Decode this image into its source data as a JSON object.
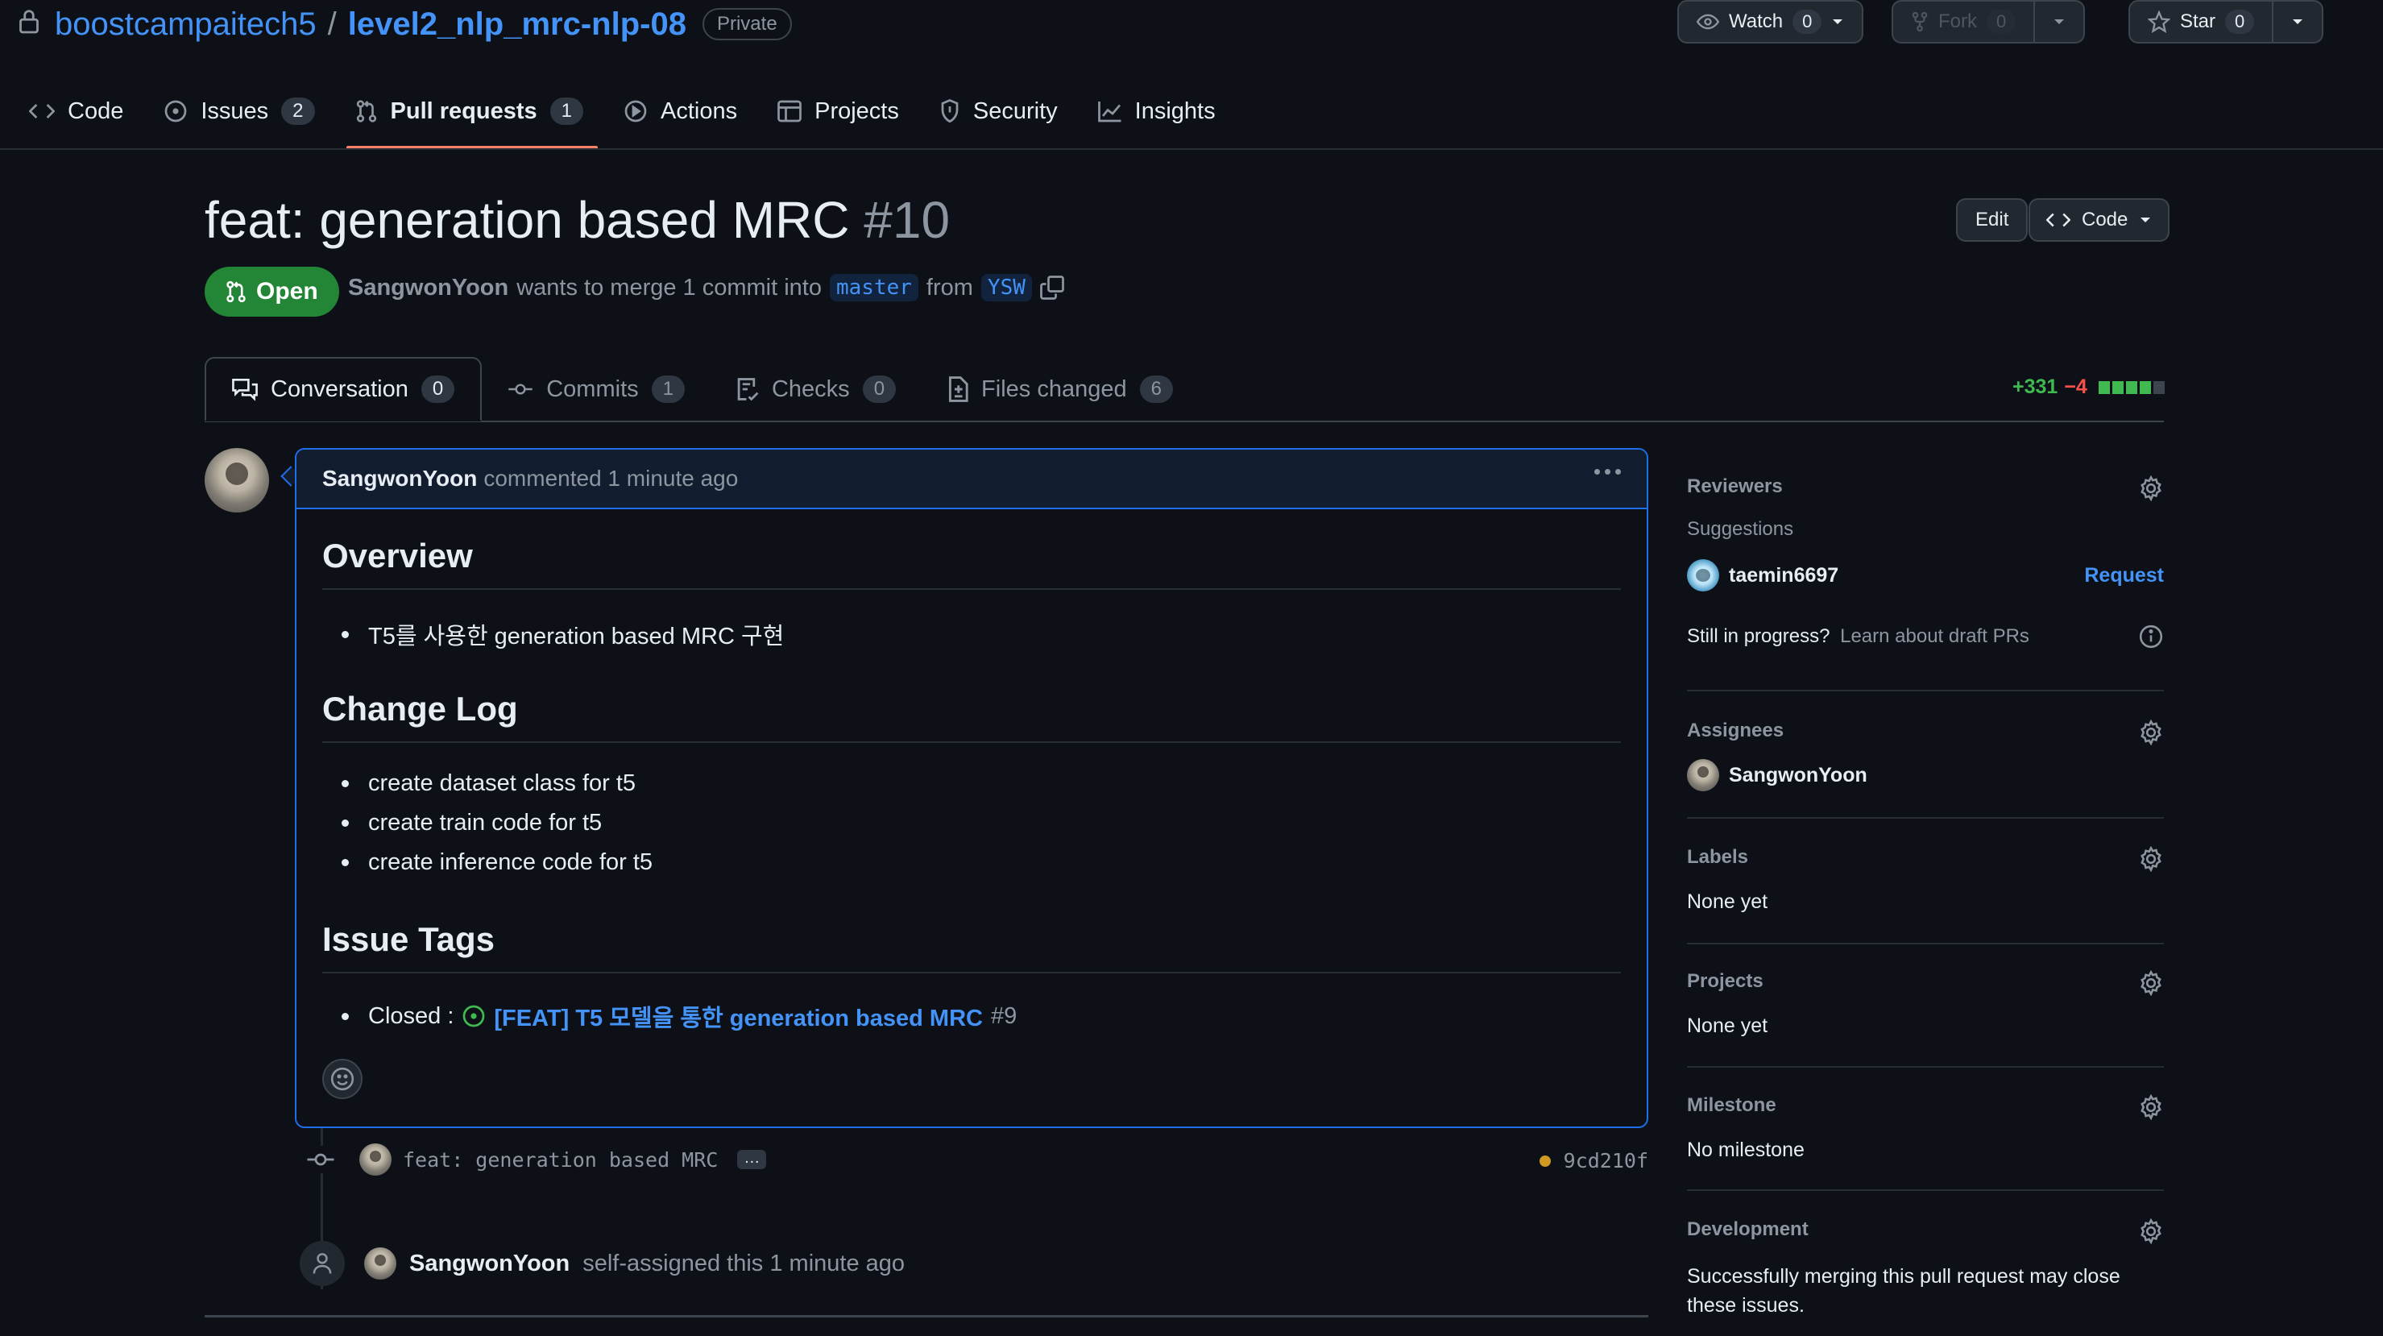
{
  "repo": {
    "owner": "boostcampaitech5",
    "separator": "/",
    "name": "level2_nlp_mrc-nlp-08",
    "visibility": "Private"
  },
  "repo_actions": {
    "watch_label": "Watch",
    "watch_count": "0",
    "fork_label": "Fork",
    "fork_count": "0",
    "star_label": "Star",
    "star_count": "0"
  },
  "repo_nav": {
    "code": "Code",
    "issues": "Issues",
    "issues_count": "2",
    "pull_requests": "Pull requests",
    "pull_requests_count": "1",
    "actions": "Actions",
    "projects": "Projects",
    "security": "Security",
    "insights": "Insights"
  },
  "pr": {
    "title": "feat: generation based MRC",
    "number": "#10",
    "state": "Open",
    "author": "SangwonYoon",
    "merge_text": "wants to merge 1 commit into",
    "base_branch": "master",
    "from_text": "from",
    "head_branch": "YSW",
    "edit_label": "Edit",
    "code_label": "Code"
  },
  "pr_tabs": {
    "conversation": "Conversation",
    "conversation_count": "0",
    "commits": "Commits",
    "commits_count": "1",
    "checks": "Checks",
    "checks_count": "0",
    "files_changed": "Files changed",
    "files_changed_count": "6"
  },
  "diffstat": {
    "additions": "+331",
    "deletions": "−4"
  },
  "comment": {
    "author": "SangwonYoon",
    "meta": "commented 1 minute ago",
    "h_overview": "Overview",
    "overview_item": "T5를 사용한 generation based MRC 구현",
    "h_changelog": "Change Log",
    "changelog": [
      "create dataset class for t5",
      "create train code for t5",
      "create inference code for t5"
    ],
    "h_issue_tags": "Issue Tags",
    "closed_label": "Closed :",
    "issue_link": "[FEAT] T5 모델을 통한 generation based MRC",
    "issue_number": "#9"
  },
  "timeline": {
    "commit_message": "feat: generation based MRC",
    "commit_ellipsis": "…",
    "commit_sha": "9cd210f",
    "assign_user": "SangwonYoon",
    "assign_text": "self-assigned this 1 minute ago"
  },
  "sidebar": {
    "reviewers_title": "Reviewers",
    "suggestions_label": "Suggestions",
    "suggested_user": "taemin6697",
    "request_label": "Request",
    "draft_text": "Still in progress?",
    "draft_link": "Learn about draft PRs",
    "assignees_title": "Assignees",
    "assignee": "SangwonYoon",
    "labels_title": "Labels",
    "labels_value": "None yet",
    "projects_title": "Projects",
    "projects_value": "None yet",
    "milestone_title": "Milestone",
    "milestone_value": "No milestone",
    "development_title": "Development",
    "development_text": "Successfully merging this pull request may close these issues."
  },
  "colors": {
    "accent_link": "#4493f8",
    "open_green": "#238636",
    "tab_underline": "#f78166",
    "additions": "#3fb950",
    "deletions": "#f85149"
  }
}
